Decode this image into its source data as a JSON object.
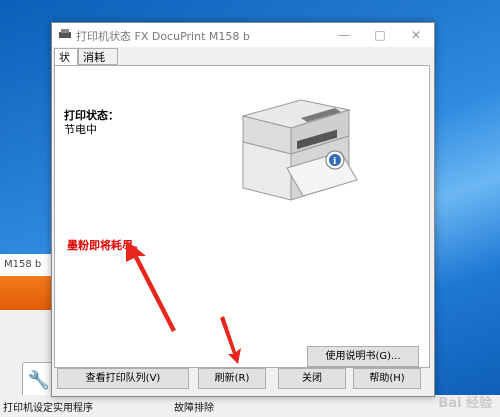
{
  "background_window": {
    "title_fragment": "M158 b",
    "app_link_1": "打印机设定实用程序",
    "app_link_2": "故障排除"
  },
  "dialog": {
    "title": "打印机状态 FX DocuPrint M158 b",
    "tabs": [
      {
        "label": "状态",
        "active": true
      },
      {
        "label": "消耗品",
        "active": false
      }
    ],
    "status_heading": "打印状态：",
    "status_value": "节电中",
    "warning": "墨粉即将耗尽。",
    "buttons": {
      "manual": "使用说明书(G)...",
      "queue": "查看打印队列(V)",
      "refresh": "刷新(R)",
      "close": "关闭",
      "help": "帮助(H)"
    }
  },
  "watermark": "Bai 经验",
  "colors": {
    "warning": "#e00000",
    "annotation_arrow": "#e8261b"
  }
}
